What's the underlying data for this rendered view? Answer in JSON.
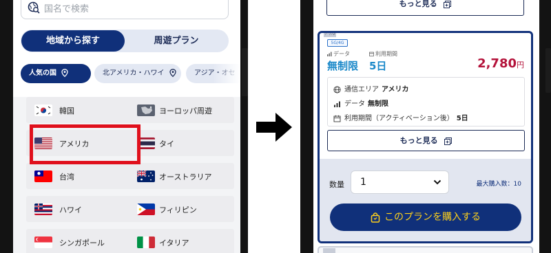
{
  "left": {
    "search": {
      "placeholder": "国名で検索"
    },
    "tabs": [
      {
        "label": "地域から探す",
        "active": true
      },
      {
        "label": "周遊プラン",
        "active": false
      }
    ],
    "chips": [
      {
        "label": "人気の国",
        "active": true
      },
      {
        "label": "北アメリカ・ハワイ",
        "active": false
      },
      {
        "label": "アジア・オセ",
        "active": false
      }
    ],
    "countries": [
      {
        "label": "韓国",
        "flag": "korea-flag"
      },
      {
        "label": "ヨーロッパ周遊",
        "flag": "europe-flag"
      },
      {
        "label": "アメリカ",
        "flag": "usa-flag",
        "highlighted": true
      },
      {
        "label": "タイ",
        "flag": "thailand-flag"
      },
      {
        "label": "台湾",
        "flag": "taiwan-flag"
      },
      {
        "label": "オーストラリア",
        "flag": "australia-flag"
      },
      {
        "label": "ハワイ",
        "flag": "hawaii-flag"
      },
      {
        "label": "フィリピン",
        "flag": "philippines-flag"
      },
      {
        "label": "シンガポール",
        "flag": "singapore-flag"
      },
      {
        "label": "イタリア",
        "flag": "italy-flag"
      }
    ],
    "highlight_color": "#e0101c"
  },
  "right": {
    "more_top_label": "もっと見る",
    "card_tag": "ﾌﾟﾗﾝ2",
    "badge": "5G/4G",
    "data_label": "データ",
    "period_label": "利用期間",
    "data_value": "無制限",
    "days_value": "5日",
    "price": "2,780",
    "price_unit": "円",
    "details": {
      "area_label": "通信エリア",
      "area_value": "アメリカ",
      "data_label": "データ",
      "data_value": "無制限",
      "period_label": "利用期間（アクティベーション後）",
      "period_value": "5日"
    },
    "more_label": "もっと見る",
    "quantity_label": "数量",
    "quantity_value": "1",
    "max_label": "最大購入数：10",
    "buy_label": "このプランを購入する"
  },
  "colors": {
    "navy": "#10307a",
    "price_red": "#b4123a",
    "accent_blue": "#1a88c9",
    "buy_text": "#ffd11a"
  }
}
